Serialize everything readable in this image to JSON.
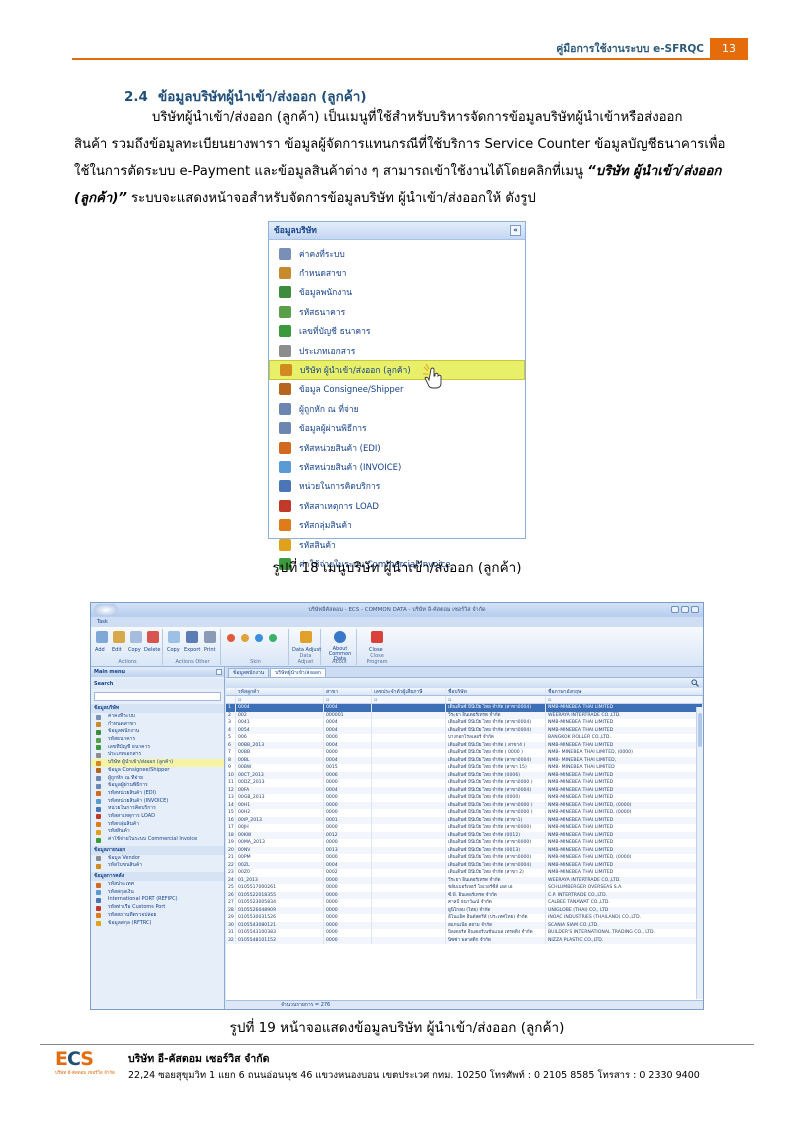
{
  "header": {
    "title": "คู่มือการใช้งานระบบ e-SFRQC",
    "page_number": "13"
  },
  "section": {
    "number": "2.4",
    "title": "ข้อมูลบริษัทผู้นำเข้า/ส่งออก (ลูกค้า)",
    "lines": [
      "บริษัทผู้นำเข้า/ส่งออก (ลูกค้า) เป็นเมนูที่ใช้สำหรับบริหารจัดการข้อมูลบริษัทผู้นำเข้าหรือส่งออก",
      "สินค้า รวมถึงข้อมูลทะเบียนยางพารา ข้อมูลผู้จัดการแทนกรณีที่ใช้บริการ Service Counter ข้อมูลบัญชีธนาคารเพื่อ",
      "ใช้ในการตัดระบบ e-Payment และข้อมูลสินค้าต่าง ๆ สามารถเข้าใช้งานได้โดยคลิกที่เมนู",
      "ระบบจะแสดงหน้าจอสำหรับจัดการข้อมูลบริษัท ผู้นำเข้า/ส่งออกให้ ดังรูป"
    ],
    "menu_path_part1": "“บริษัท ผู้นำเข้า/ส่งออก",
    "menu_path_part2": "(ลูกค้า)”"
  },
  "menu_figure": {
    "title": "ข้อมูลบริษัท",
    "collapse_glyph": "«",
    "items": [
      {
        "label": "ค่าคงที่ระบบ",
        "icon": "settings-icon",
        "color": "#7a8fb5"
      },
      {
        "label": "กำหนดสาขา",
        "icon": "branch-icon",
        "color": "#c98a2e"
      },
      {
        "label": "ข้อมูลพนักงาน",
        "icon": "employee-icon",
        "color": "#3d8b3d"
      },
      {
        "label": "รหัสธนาคาร",
        "icon": "bank-icon",
        "color": "#5aa04a"
      },
      {
        "label": "เลขที่บัญชี ธนาคาร",
        "icon": "account-icon",
        "color": "#3b9a3b"
      },
      {
        "label": "ประเภทเอกสาร",
        "icon": "document-type-icon",
        "color": "#8c8c8c"
      },
      {
        "label": "บริษัท ผู้นำเข้า/ส่งออก (ลูกค้า)",
        "icon": "company-icon",
        "color": "#d18a1f"
      },
      {
        "label": "ข้อมูล Consignee/Shipper",
        "icon": "consignee-icon",
        "color": "#b5651d"
      },
      {
        "label": "ผู้ถูกหัก ณ ที่จ่าย",
        "icon": "withholding-icon",
        "color": "#6b86b0"
      },
      {
        "label": "ข้อมูลผู้ผ่านพิธีการ",
        "icon": "customs-broker-icon",
        "color": "#6b86b0"
      },
      {
        "label": "รหัสหน่วยสินค้า (EDI)",
        "icon": "unit-edi-icon",
        "color": "#d2691e"
      },
      {
        "label": "รหัสหน่วยสินค้า (INVOICE)",
        "icon": "unit-invoice-icon",
        "color": "#5b9bd5"
      },
      {
        "label": "หน่วยในการคิดบริการ",
        "icon": "service-unit-icon",
        "color": "#4a76b8"
      },
      {
        "label": "รหัสสาเหตุการ LOAD",
        "icon": "load-reason-icon",
        "color": "#c0392b"
      },
      {
        "label": "รหัสกลุ่มสินค้า",
        "icon": "product-group-icon",
        "color": "#e07b1a"
      },
      {
        "label": "รหัสสินค้า",
        "icon": "product-icon",
        "color": "#e0a21a"
      },
      {
        "label": "ค่าใช้จ่ายในระบบ Commercial Invoice",
        "icon": "invoice-expense-icon",
        "color": "#3b9a3b"
      }
    ],
    "active_index": 6,
    "caption": "รูปที่ 18 เมนูบริษัท ผู้นำเข้า/ส่งออก (ลูกค้า)"
  },
  "screenshot_figure": {
    "window_title": "บริษัทอีคัสตอม - ECS - COMMON DATA - บริษัท อี-คัสตอม เซอร์วิส จำกัด",
    "ribbon_tab": "Task",
    "ribbon_groups": [
      {
        "label": "Actions",
        "buttons": [
          "Add",
          "Edit",
          "Copy",
          "Delete"
        ]
      },
      {
        "label": "Actions Other",
        "buttons": [
          "Copy",
          "Export",
          "Print"
        ]
      },
      {
        "label": "Skin",
        "buttons": []
      },
      {
        "label": "Data Adjust",
        "buttons": [
          "Data Adjust"
        ]
      },
      {
        "label": "About",
        "buttons": [
          "About Common Data"
        ]
      },
      {
        "label": "Close Program",
        "buttons": [
          "Close"
        ]
      }
    ],
    "left_pane": {
      "title": "Main menu",
      "search_label": "Search",
      "groups": [
        {
          "title": "ข้อมูลบริษัท",
          "items": [
            "ค่าคงที่ระบบ",
            "กำหนดสาขา",
            "ข้อมูลพนักงาน",
            "รหัสธนาคาร",
            "เลขที่บัญชี ธนาคาร",
            "ประเภทเอกสาร",
            "บริษัท ผู้นำเข้า/ส่งออก (ลูกค้า)",
            "ข้อมูล Consignee/Shipper",
            "ผู้ถูกหัก ณ ที่จ่าย",
            "ข้อมูลผู้ผ่านพิธีการ",
            "รหัสหน่วยสินค้า (EDI)",
            "รหัสหน่วยสินค้า (INVOICE)",
            "หน่วยในการคิดบริการ",
            "รหัสสาเหตุการ LOAD",
            "รหัสกลุ่มสินค้า",
            "รหัสสินค้า",
            "ค่าใช้จ่ายในระบบ Commercial Invoice"
          ]
        },
        {
          "title": "ข้อมูลภายนอก",
          "items": [
            "ข้อมูล Vendor",
            "รหัสใบขนสินค้า"
          ]
        },
        {
          "title": "ข้อมูลการคลัง",
          "items": [
            "รหัสประเทศ",
            "รหัสสกุลเงิน",
            "International PORT (REFIPC)",
            "รหัสท่าเรือ Customs Port",
            "รหัสสถานที่ตรวจปล่อย",
            "ข้อมูลสกุล (RFTRC)"
          ]
        }
      ]
    },
    "doc_tabs": [
      "ข้อมูลพนักงาน",
      "บริษัทผู้นำเข้า/ส่งออก"
    ],
    "grid_headers": [
      "",
      "รหัสลูกค้า",
      "สาขา",
      "เลขประจำตัวผู้เสียภาษี",
      "ชื่อบริษัท",
      "ชื่อภาษาอังกฤษ"
    ],
    "rows": [
      [
        "1",
        "0004",
        "0004",
        "",
        "เด็นเด็นซ์ มินีเบีย ไทย จำกัด (สาขา0004)",
        "NMB-MINEBEA THAI LIMITED"
      ],
      [
        "2",
        "002",
        "000001",
        "",
        "วีระยา อินเตอร์เทรด จำกัด",
        "WEERAYA INTERTRADE CO.,LTD."
      ],
      [
        "3",
        "0041",
        "0004",
        "",
        "เด็นเด็นซ์ มินีเบีย ไทย จำกัด (สาขา0004)",
        "NMB-MINEBEA THAI LIMITED"
      ],
      [
        "4",
        "0054",
        "0004",
        "",
        "เด็นเด็นซ์ มินีเบีย ไทย จำกัด (สาขา0004)",
        "NMB-MINEBEA THAI LIMITED"
      ],
      [
        "5",
        "006",
        "0000",
        "",
        "บางกอกโรลเลอร์ จำกัด",
        "BANGKOK ROLLER CO.,LTD."
      ],
      [
        "6",
        "00BB_2013",
        "0004",
        "",
        "เด็นเด็นซ์ มินีเบีย ไทย จำกัด ( สาขา4 )",
        "NMB-MINEBEA THAI LIMITED"
      ],
      [
        "7",
        "00BB",
        "0000",
        "",
        "เด็นเด็นซ์ มินีเบีย ไทย จำกัด ( 0000 )",
        "NMB- MINEBEA THAI LIMITED, (0000)"
      ],
      [
        "8",
        "00BL",
        "0004",
        "",
        "เด็นเด็นซ์ มินีเบีย ไทย จำกัด (สาขา0004)",
        "NMB- MINEBEA THAI LIMITED,"
      ],
      [
        "9",
        "00BW",
        "0015",
        "",
        "เด็นเด็นซ์ มินีเบีย ไทย จำกัด (สาขา 15)",
        "NMB- MINEBEA THAI LIMITED"
      ],
      [
        "10",
        "00CT_2013",
        "0006",
        "",
        "เด็นเด็นซ์ มินีเบีย ไทย จำกัด (0006)",
        "NMB-MINEBEA THAI LIMITED"
      ],
      [
        "11",
        "00DZ_2013",
        "0000",
        "",
        "เด็นเด็นซ์ มินีเบีย ไทย จำกัด (สาขา0000 )",
        "NMB-MINEBEA THAI LIMITED"
      ],
      [
        "12",
        "00FA",
        "0004",
        "",
        "เด็นเด็นซ์ มินีเบีย ไทย จำกัด (สาขา0004)",
        "NMB-MINEBEA THAI LIMITED"
      ],
      [
        "13",
        "00GB_2013",
        "0000",
        "",
        "เด็นเด็นซ์ มินีเบีย ไทย จำกัด (0000)",
        "NMB-MINEBEA THAI LIMITED"
      ],
      [
        "14",
        "00H1",
        "0000",
        "",
        "เด็นเด็นซ์ มินีเบีย ไทย จำกัด (สาขา0000 )",
        "NMB-MINEBEA THAI LIMITED, (0000)"
      ],
      [
        "15",
        "00H2",
        "0000",
        "",
        "เด็นเด็นซ์ มินีเบีย ไทย จำกัด (สาขา0000 )",
        "NMB-MINEBEA THAI LIMITED, (0000)"
      ],
      [
        "16",
        "00IP_2013",
        "0001",
        "",
        "เด็นเด็นซ์ มินีเบีย ไทย จำกัด (สาขา1)",
        "NMB-MINEBEA THAI LIMITED"
      ],
      [
        "17",
        "00JH",
        "0000",
        "",
        "เด็นเด็นซ์ มินีเบีย ไทย จำกัด (สาขา0000)",
        "NMB-MINEBEA THAI LIMITED"
      ],
      [
        "18",
        "00KW",
        "0012",
        "",
        "เด็นเด็นซ์ มินีเบีย ไทย จำกัด (0012)",
        "NMB-MINEBEA THAI LIMITED"
      ],
      [
        "19",
        "00MA_2013",
        "0000",
        "",
        "เด็นเด็นซ์ มินีเบีย ไทย จำกัด (สาขา0000)",
        "NMB-MINEBEA THAI LIMITED"
      ],
      [
        "20",
        "00NV",
        "0013",
        "",
        "เด็นเด็นซ์ มินีเบีย ไทย จำกัด (0013)",
        "NMB-MINEBEA THAI LIMITED"
      ],
      [
        "21",
        "00PM",
        "0000",
        "",
        "เด็นเด็นซ์ มินีเบีย ไทย จำกัด (สาขา0000)",
        "NMB-MINEBEA THAI LIMITED, (0000)"
      ],
      [
        "22",
        "00ZL",
        "0004",
        "",
        "เด็นเด็นซ์ มินีเบีย ไทย จำกัด (สาขา0004)",
        "NMB-MINEBEA THAI LIMITED"
      ],
      [
        "23",
        "00Z0",
        "0002",
        "",
        "เด็นเด็นซ์ มินีเบีย ไทย จำกัด (สาขา 2)",
        "NMB-MINEBEA THAI LIMITED"
      ],
      [
        "24",
        "01_2013",
        "0000",
        "",
        "วีระยา อินเตอร์เทรด จำกัด",
        "WEERAYA INTERTRADE CO.,LTD."
      ],
      [
        "25",
        "0105517000261",
        "0000",
        "",
        "ชลัมเบอร์เจอร์ โอเวอร์ซีส์ เอส เอ",
        "SCHLUMBERGER OVERSEAS S.A."
      ],
      [
        "26",
        "0105522018355",
        "0000",
        "",
        "ซี.พี. อินเตอร์เทรด จำกัด",
        "C.P. INTERTRADE CO.,LTD."
      ],
      [
        "27",
        "0105523005834",
        "0000",
        "",
        "คาลบี้ ธนาวัฒน์ จำกัด",
        "CALBEE TANAWAT CO.,LTD."
      ],
      [
        "28",
        "0105526048909",
        "0000",
        "",
        "ยูนิโกลบ (ไทย) จำกัด",
        "UNIGLOBE (THAI) CO., LTD"
      ],
      [
        "29",
        "0105530031526",
        "0000",
        "",
        "อีโนแอ็ค อินดัสตรีส์ (ประเทศไทย) จำกัด",
        "INOAC INDUSTRIES (THAILAND) CO.,LTD."
      ],
      [
        "30",
        "0105543080121",
        "0000",
        "",
        "สแกนเนีย สยาม จำกัด",
        "SCANIA SIAM CO.,LTD."
      ],
      [
        "31",
        "0105543100383",
        "0000",
        "",
        "บิลเดอร์ส อินเตอร์เนชั่นแนล เทรดดิ้ง จำกัด",
        "BUILDER'S INTERNATIONAL TRADING CO., LTD."
      ],
      [
        "32",
        "0105548101152",
        "0000",
        "",
        "นิซซ่า พลาสติก จำกัด",
        "NIZZA PLASTIC CO.,LTD."
      ]
    ],
    "footer_count": "จำนวนรายการ = 276",
    "caption": "รูปที่ 19 หน้าจอแสดงข้อมูลบริษัท ผู้นำเข้า/ส่งออก (ลูกค้า)"
  },
  "footer": {
    "logo_text_1": "E",
    "logo_text_2": "C",
    "logo_text_3": "S",
    "logo_sub": "บริษัท อี-คัสตอม เซอร์วิส จำกัด",
    "company_name": "บริษัท อี-คัสตอม เซอร์วิส จำกัด",
    "address": "22,24 ซอยสุขุมวิท 1 แยก 6 ถนนอ่อนนุช 46 แขวงหนองบอน เขตประเวศ กทม. 10250 โทรศัพท์ : 0 2105 8585  โทรสาร : 0 2330 9400"
  },
  "colors": {
    "accent": "#e46c0a",
    "heading": "#1f4e79",
    "menu_highlight": "#e8f06a"
  }
}
